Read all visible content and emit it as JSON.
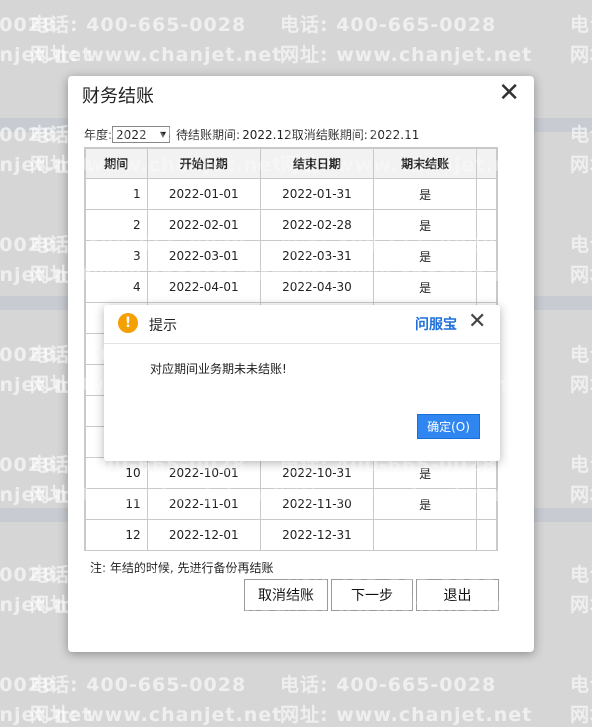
{
  "watermark": {
    "phone": "电话: 400-665-0028",
    "site": "网址: www.chanjet.net"
  },
  "dialog": {
    "title": "财务结账",
    "close_icon": "close-icon",
    "year_label": "年度:",
    "year_value": "2022",
    "pending_label": "待结账期间:",
    "pending_value": "2022.12",
    "cancel_period_label": "取消结账期间:",
    "cancel_period_value": "2022.11",
    "table": {
      "headers": [
        "期间",
        "开始日期",
        "结束日期",
        "期末结账"
      ],
      "rows": [
        [
          "1",
          "2022-01-01",
          "2022-01-31",
          "是"
        ],
        [
          "2",
          "2022-02-01",
          "2022-02-28",
          "是"
        ],
        [
          "3",
          "2022-03-01",
          "2022-03-31",
          "是"
        ],
        [
          "4",
          "2022-04-01",
          "2022-04-30",
          "是"
        ],
        [
          "",
          "",
          "",
          ""
        ],
        [
          "",
          "",
          "",
          ""
        ],
        [
          "",
          "",
          "",
          ""
        ],
        [
          "",
          "",
          "",
          ""
        ],
        [
          "",
          "",
          "",
          ""
        ],
        [
          "10",
          "2022-10-01",
          "2022-10-31",
          "是"
        ],
        [
          "11",
          "2022-11-01",
          "2022-11-30",
          "是"
        ],
        [
          "12",
          "2022-12-01",
          "2022-12-31",
          ""
        ]
      ]
    },
    "note": "注: 年结的时候, 先进行备份再结账",
    "buttons": {
      "cancel_close": "取消结账",
      "next": "下一步",
      "exit": "退出"
    }
  },
  "alert": {
    "icon": "warning-icon",
    "title": "提示",
    "help_link": "问服宝",
    "message": "对应期间业务期未未结账!",
    "ok_label": "确定(O)"
  }
}
